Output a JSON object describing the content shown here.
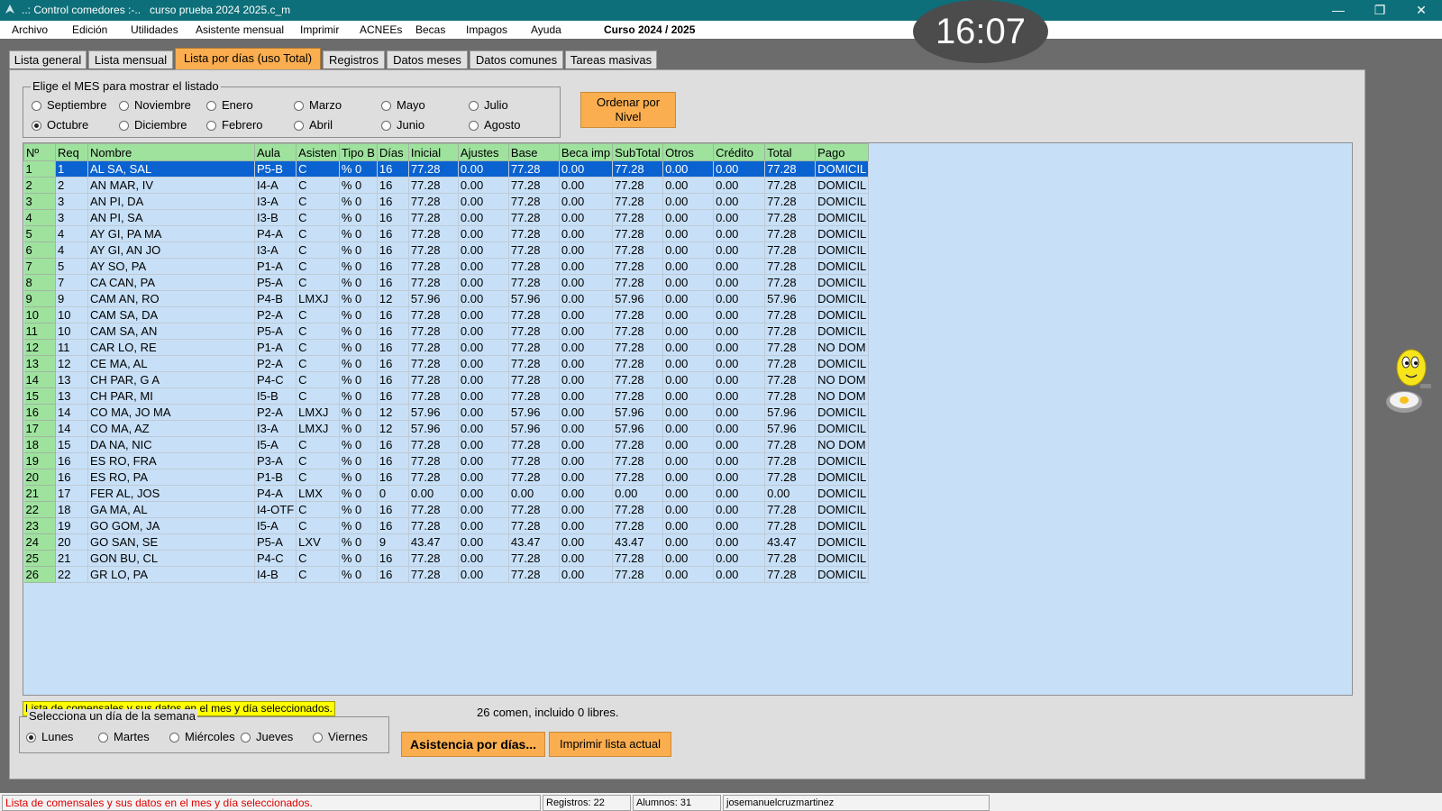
{
  "window": {
    "title": "..: Control comedores :-..   curso prueba 2024 2025.c_m",
    "minimize": "—",
    "maximize": "❐",
    "close": "✕",
    "clock": "16:07"
  },
  "menu": {
    "items": [
      "Archivo",
      "Edición",
      "Utilidades",
      "Asistente mensual",
      "Imprimir",
      "ACNEEs",
      "Becas",
      "Impagos",
      "Ayuda"
    ],
    "course": "Curso 2024 / 2025"
  },
  "tabs": [
    {
      "label": "Lista general"
    },
    {
      "label": "Lista mensual"
    },
    {
      "label": "Lista por días (uso Total)",
      "active": true
    },
    {
      "label": "Registros"
    },
    {
      "label": "Datos meses"
    },
    {
      "label": "Datos comunes"
    },
    {
      "label": "Tareas masivas"
    }
  ],
  "month_selector": {
    "legend": "Elige el MES para mostrar el listado",
    "months": [
      "Septiembre",
      "Octubre",
      "Noviembre",
      "Diciembre",
      "Enero",
      "Febrero",
      "Marzo",
      "Abril",
      "Mayo",
      "Junio",
      "Julio",
      "Agosto"
    ],
    "selected": "Octubre"
  },
  "order_button": {
    "line1": "Ordenar por",
    "line2": "Nivel"
  },
  "table": {
    "columns": [
      "Nº",
      "Req",
      "Nombre",
      "Aula",
      "Asisten",
      "Tipo B",
      "Días",
      "Inicial",
      "Ajustes",
      "Base",
      "Beca imp",
      "SubTotal",
      "Otros",
      "Crédito",
      "Total",
      "Pago"
    ],
    "rows": [
      [
        "1",
        "1",
        "AL SA, SAL",
        "P5-B",
        "C",
        "% 0",
        "16",
        "77.28",
        "0.00",
        "77.28",
        "0.00",
        "77.28",
        "0.00",
        "0.00",
        "77.28",
        "DOMICIL"
      ],
      [
        "2",
        "2",
        "AN MAR, IV",
        "I4-A",
        "C",
        "% 0",
        "16",
        "77.28",
        "0.00",
        "77.28",
        "0.00",
        "77.28",
        "0.00",
        "0.00",
        "77.28",
        "DOMICIL"
      ],
      [
        "3",
        "3",
        "AN PI, DA",
        "I3-A",
        "C",
        "% 0",
        "16",
        "77.28",
        "0.00",
        "77.28",
        "0.00",
        "77.28",
        "0.00",
        "0.00",
        "77.28",
        "DOMICIL"
      ],
      [
        "4",
        "3",
        "AN PI, SA",
        "I3-B",
        "C",
        "% 0",
        "16",
        "77.28",
        "0.00",
        "77.28",
        "0.00",
        "77.28",
        "0.00",
        "0.00",
        "77.28",
        "DOMICIL"
      ],
      [
        "5",
        "4",
        "AY GI, PA MA",
        "P4-A",
        "C",
        "% 0",
        "16",
        "77.28",
        "0.00",
        "77.28",
        "0.00",
        "77.28",
        "0.00",
        "0.00",
        "77.28",
        "DOMICIL"
      ],
      [
        "6",
        "4",
        "AY GI, AN JO",
        "I3-A",
        "C",
        "% 0",
        "16",
        "77.28",
        "0.00",
        "77.28",
        "0.00",
        "77.28",
        "0.00",
        "0.00",
        "77.28",
        "DOMICIL"
      ],
      [
        "7",
        "5",
        "AY SO, PA",
        "P1-A",
        "C",
        "% 0",
        "16",
        "77.28",
        "0.00",
        "77.28",
        "0.00",
        "77.28",
        "0.00",
        "0.00",
        "77.28",
        "DOMICIL"
      ],
      [
        "8",
        "7",
        "CA CAN, PA",
        "P5-A",
        "C",
        "% 0",
        "16",
        "77.28",
        "0.00",
        "77.28",
        "0.00",
        "77.28",
        "0.00",
        "0.00",
        "77.28",
        "DOMICIL"
      ],
      [
        "9",
        "9",
        "CAM AN, RO",
        "P4-B",
        "LMXJ",
        "% 0",
        "12",
        "57.96",
        "0.00",
        "57.96",
        "0.00",
        "57.96",
        "0.00",
        "0.00",
        "57.96",
        "DOMICIL"
      ],
      [
        "10",
        "10",
        "CAM SA, DA",
        "P2-A",
        "C",
        "% 0",
        "16",
        "77.28",
        "0.00",
        "77.28",
        "0.00",
        "77.28",
        "0.00",
        "0.00",
        "77.28",
        "DOMICIL"
      ],
      [
        "11",
        "10",
        "CAM SA, AN",
        "P5-A",
        "C",
        "% 0",
        "16",
        "77.28",
        "0.00",
        "77.28",
        "0.00",
        "77.28",
        "0.00",
        "0.00",
        "77.28",
        "DOMICIL"
      ],
      [
        "12",
        "11",
        "CAR LO, RE",
        "P1-A",
        "C",
        "% 0",
        "16",
        "77.28",
        "0.00",
        "77.28",
        "0.00",
        "77.28",
        "0.00",
        "0.00",
        "77.28",
        "NO DOM"
      ],
      [
        "13",
        "12",
        "CE MA, AL",
        "P2-A",
        "C",
        "% 0",
        "16",
        "77.28",
        "0.00",
        "77.28",
        "0.00",
        "77.28",
        "0.00",
        "0.00",
        "77.28",
        "DOMICIL"
      ],
      [
        "14",
        "13",
        "CH PAR, G A",
        "P4-C",
        "C",
        "% 0",
        "16",
        "77.28",
        "0.00",
        "77.28",
        "0.00",
        "77.28",
        "0.00",
        "0.00",
        "77.28",
        "NO DOM"
      ],
      [
        "15",
        "13",
        "CH PAR, MI",
        "I5-B",
        "C",
        "% 0",
        "16",
        "77.28",
        "0.00",
        "77.28",
        "0.00",
        "77.28",
        "0.00",
        "0.00",
        "77.28",
        "NO DOM"
      ],
      [
        "16",
        "14",
        "CO MA, JO MA",
        "P2-A",
        "LMXJ",
        "% 0",
        "12",
        "57.96",
        "0.00",
        "57.96",
        "0.00",
        "57.96",
        "0.00",
        "0.00",
        "57.96",
        "DOMICIL"
      ],
      [
        "17",
        "14",
        "CO MA, AZ",
        "I3-A",
        "LMXJ",
        "% 0",
        "12",
        "57.96",
        "0.00",
        "57.96",
        "0.00",
        "57.96",
        "0.00",
        "0.00",
        "57.96",
        "DOMICIL"
      ],
      [
        "18",
        "15",
        "DA NA, NIC",
        "I5-A",
        "C",
        "% 0",
        "16",
        "77.28",
        "0.00",
        "77.28",
        "0.00",
        "77.28",
        "0.00",
        "0.00",
        "77.28",
        "NO DOM"
      ],
      [
        "19",
        "16",
        "ES RO, FRA",
        "P3-A",
        "C",
        "% 0",
        "16",
        "77.28",
        "0.00",
        "77.28",
        "0.00",
        "77.28",
        "0.00",
        "0.00",
        "77.28",
        "DOMICIL"
      ],
      [
        "20",
        "16",
        "ES RO, PA",
        "P1-B",
        "C",
        "% 0",
        "16",
        "77.28",
        "0.00",
        "77.28",
        "0.00",
        "77.28",
        "0.00",
        "0.00",
        "77.28",
        "DOMICIL"
      ],
      [
        "21",
        "17",
        "FER AL, JOS",
        "P4-A",
        "LMX",
        "% 0",
        "0",
        "0.00",
        "0.00",
        "0.00",
        "0.00",
        "0.00",
        "0.00",
        "0.00",
        "0.00",
        "DOMICIL"
      ],
      [
        "22",
        "18",
        "GA MA, AL",
        "I4-OTF",
        "C",
        "% 0",
        "16",
        "77.28",
        "0.00",
        "77.28",
        "0.00",
        "77.28",
        "0.00",
        "0.00",
        "77.28",
        "DOMICIL"
      ],
      [
        "23",
        "19",
        "GO GOM, JA",
        "I5-A",
        "C",
        "% 0",
        "16",
        "77.28",
        "0.00",
        "77.28",
        "0.00",
        "77.28",
        "0.00",
        "0.00",
        "77.28",
        "DOMICIL"
      ],
      [
        "24",
        "20",
        "GO SAN, SE",
        "P5-A",
        "LXV",
        "% 0",
        "9",
        "43.47",
        "0.00",
        "43.47",
        "0.00",
        "43.47",
        "0.00",
        "0.00",
        "43.47",
        "DOMICIL"
      ],
      [
        "25",
        "21",
        "GON BU, CL",
        "P4-C",
        "C",
        "% 0",
        "16",
        "77.28",
        "0.00",
        "77.28",
        "0.00",
        "77.28",
        "0.00",
        "0.00",
        "77.28",
        "DOMICIL"
      ],
      [
        "26",
        "22",
        "GR LO, PA",
        "I4-B",
        "C",
        "% 0",
        "16",
        "77.28",
        "0.00",
        "77.28",
        "0.00",
        "77.28",
        "0.00",
        "0.00",
        "77.28",
        "DOMICIL"
      ]
    ],
    "selected_row": 0
  },
  "info_label": "Lista de comensales y sus datos en el mes y día seleccionados.",
  "count_text": "26  comen, incluido 0 libres.",
  "day_selector": {
    "legend": "Selecciona un día de la semana",
    "days": [
      "Lunes",
      "Martes",
      "Miércoles",
      "Jueves",
      "Viernes"
    ],
    "selected": "Lunes"
  },
  "buttons": {
    "attendance": "Asistencia por días...",
    "print": "Imprimir lista actual"
  },
  "status": {
    "message": "Lista de comensales y sus datos en el mes y día seleccionados.",
    "registros": "Registros: 22",
    "alumnos": "Alumnos: 31",
    "user": "josemanuelcruzmartinez"
  },
  "colors": {
    "titlebar": "#0d6f79",
    "accent_orange": "#fbae4f",
    "grid_background": "#c7e0f7",
    "header_green": "#9ee29e",
    "selection_blue": "#0a62d0",
    "status_red": "#e00000"
  }
}
